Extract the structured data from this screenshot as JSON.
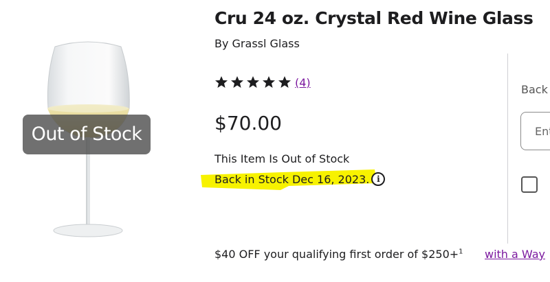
{
  "product": {
    "title": "Cru 24 oz. Crystal Red Wine Glass",
    "brand": "By Grassl Glass",
    "rating_stars": 5,
    "review_count": "(4)",
    "price": "$70.00",
    "image_badge": "Out of Stock",
    "out_of_stock_text": "This Item Is Out of Stock",
    "back_in_stock_text": "Back in Stock Dec 16, 2023.",
    "info_icon_glyph": "i"
  },
  "side_panel": {
    "label": "Back",
    "input_placeholder": "Ent"
  },
  "promo": {
    "text": "$40 OFF your qualifying first order of $250+",
    "footnote": "1",
    "link": "with a Way"
  },
  "colors": {
    "link": "#7b189f",
    "highlight": "#f7f200",
    "badge_bg": "#505050"
  }
}
